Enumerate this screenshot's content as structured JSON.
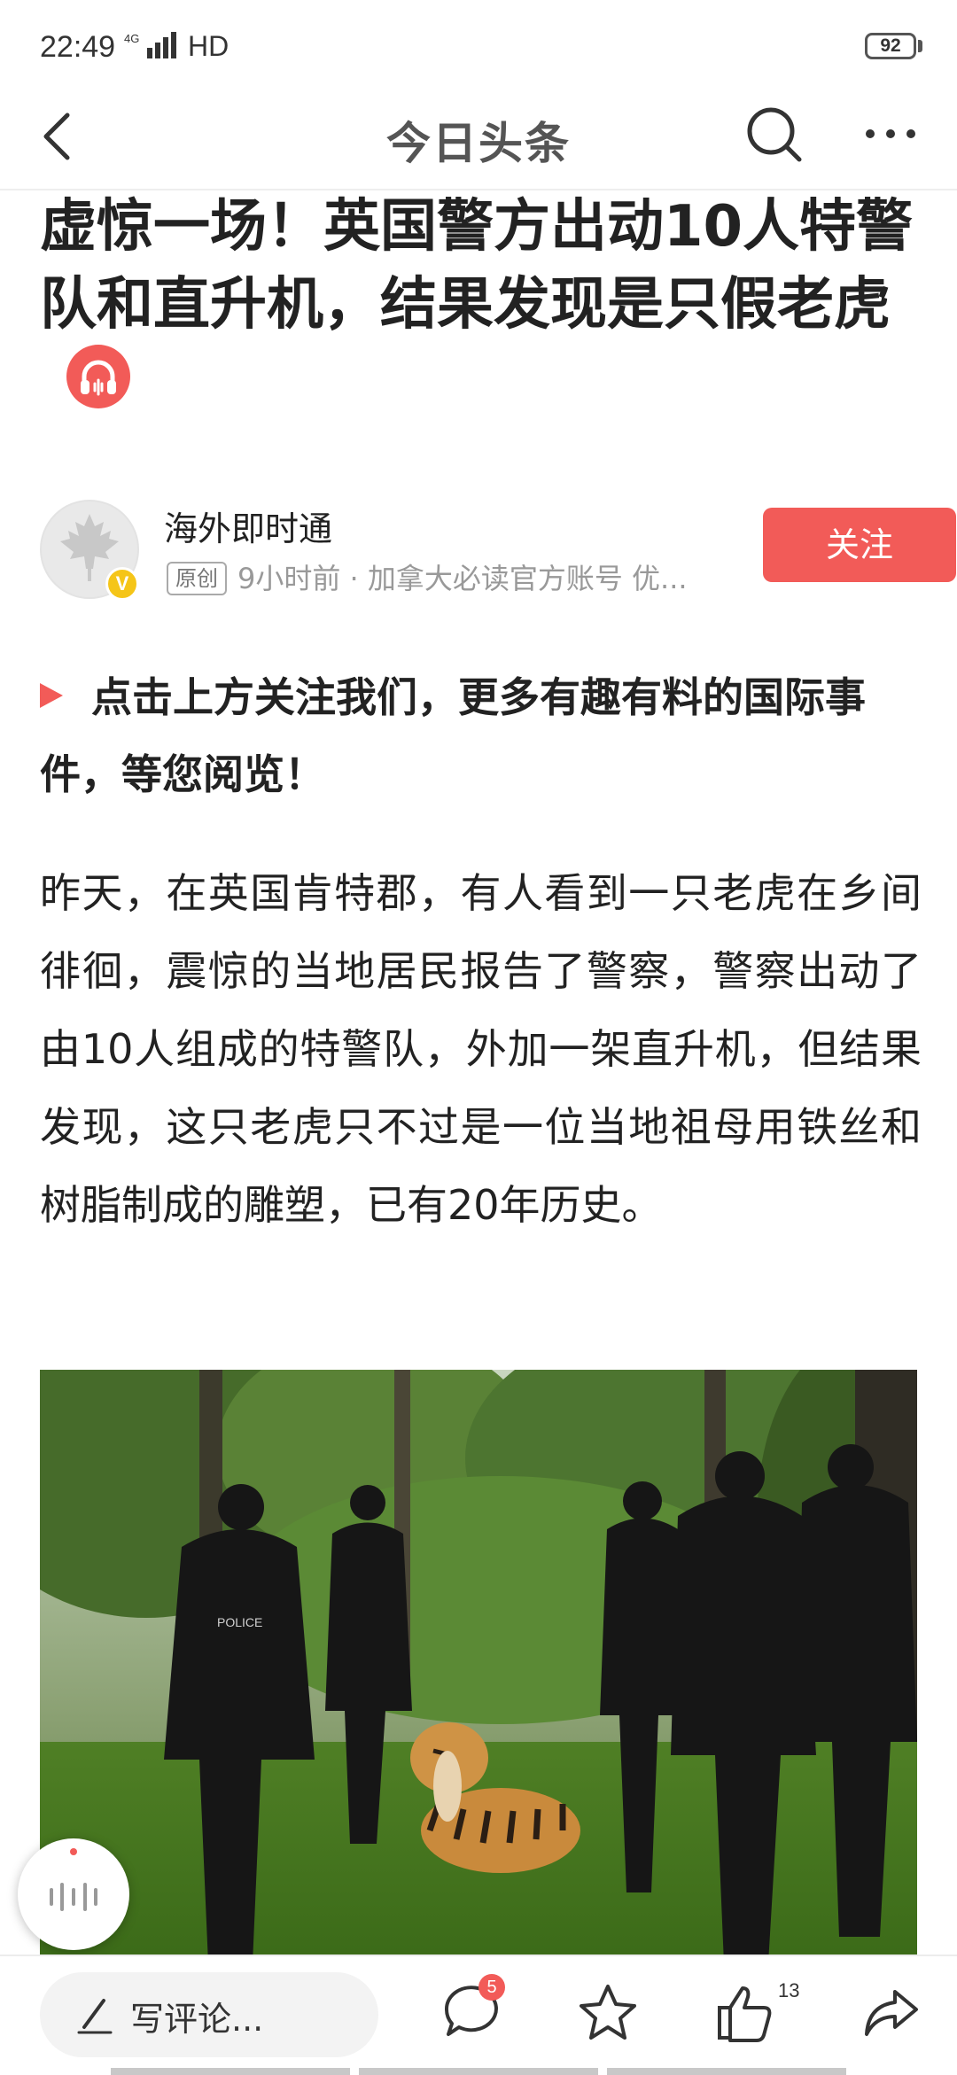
{
  "status_bar": {
    "time": "22:49",
    "signal": "4G",
    "network": "HD",
    "battery": "92"
  },
  "nav": {
    "title": "今日头条",
    "icons": [
      "back-arrow-icon",
      "search-icon",
      "more-icon"
    ]
  },
  "article": {
    "title": "虚惊一场！英国警方出动10人特警队和直升机，结果发现是只假老虎",
    "author": {
      "name": "海外即时通",
      "original_tag": "原创",
      "meta": "9小时前 · 加拿大必读官方账号 优...",
      "verified_badge": "V",
      "follow_label": "关注"
    },
    "promo": "点击上方关注我们，更多有趣有料的国际事件，等您阅览！",
    "paragraph": "昨天，在英国肯特郡，有人看到一只老虎在乡间徘徊，震惊的当地居民报告了警察，警察出动了由10人组成的特警队，外加一架直升机，但结果发现，这只老虎只不过是一位当地祖母用铁丝和树脂制成的雕塑，已有20年历史。",
    "photo_police_text": "POLICE"
  },
  "bottom_bar": {
    "comment_placeholder": "写评论...",
    "comment_count": "5",
    "like_count": "13"
  },
  "colors": {
    "accent": "#f25b58",
    "verified": "#f5c518"
  }
}
